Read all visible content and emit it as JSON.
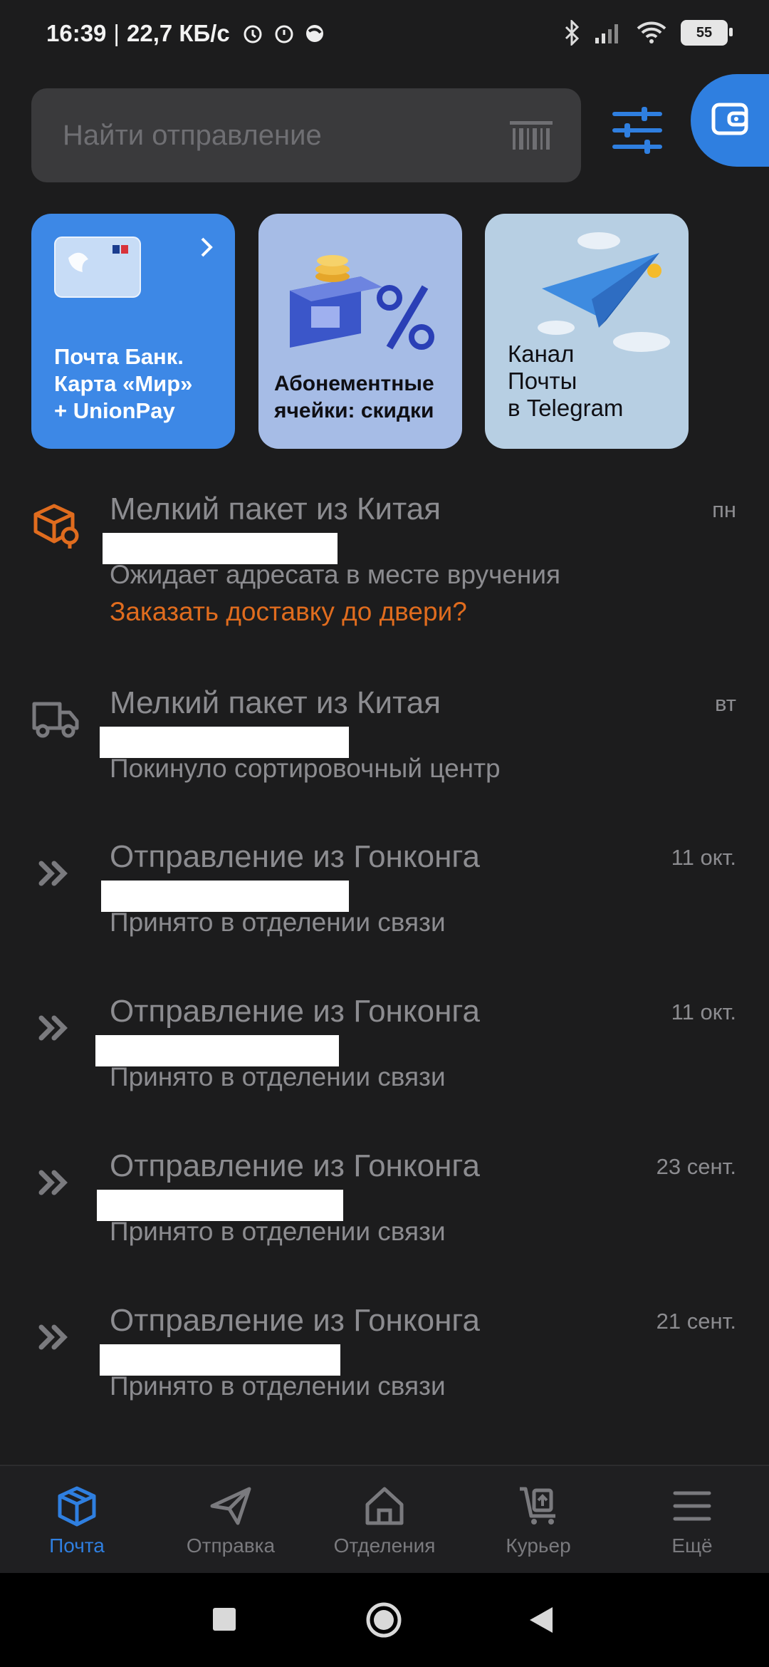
{
  "status_bar": {
    "time": "16:39",
    "separator": "|",
    "net_speed": "22,7 КБ/с",
    "battery": "55"
  },
  "search": {
    "placeholder": "Найти отправление"
  },
  "banners": [
    {
      "text": "Почта Банк.\nКарта «Мир»\n+ UnionPay"
    },
    {
      "text": "Абонементные\nячейки: скидки"
    },
    {
      "text": "Канал\nПочты\nв Telegram"
    }
  ],
  "shipments": [
    {
      "icon": "package-location-icon",
      "title": "Мелкий пакет из Китая",
      "date": "пн",
      "status": "Ожидает адресата в месте вручения",
      "action": "Заказать доставку до двери?"
    },
    {
      "icon": "truck-icon",
      "title": "Мелкий пакет из Китая",
      "date": "вт",
      "status": "Покинуло сортировочный центр"
    },
    {
      "icon": "double-chevron-icon",
      "title": "Отправление из Гонконга",
      "date": "11 окт.",
      "status": "Принято в отделении связи"
    },
    {
      "icon": "double-chevron-icon",
      "title": "Отправление из Гонконга",
      "date": "11 окт.",
      "status": "Принято в отделении связи"
    },
    {
      "icon": "double-chevron-icon",
      "title": "Отправление из Гонконга",
      "date": "23 сент.",
      "status": "Принято в отделении связи"
    },
    {
      "icon": "double-chevron-icon",
      "title": "Отправление из Гонконга",
      "date": "21 сент.",
      "status": "Принято в отделении связи"
    }
  ],
  "bottom_nav": [
    {
      "label": "Почта",
      "active": true
    },
    {
      "label": "Отправка"
    },
    {
      "label": "Отделения"
    },
    {
      "label": "Курьер"
    },
    {
      "label": "Ещё"
    }
  ],
  "colors": {
    "background": "#1c1c1d",
    "accent_blue": "#2f7fe0",
    "accent_orange": "#e06c1e",
    "muted_text": "#8c8c90"
  }
}
